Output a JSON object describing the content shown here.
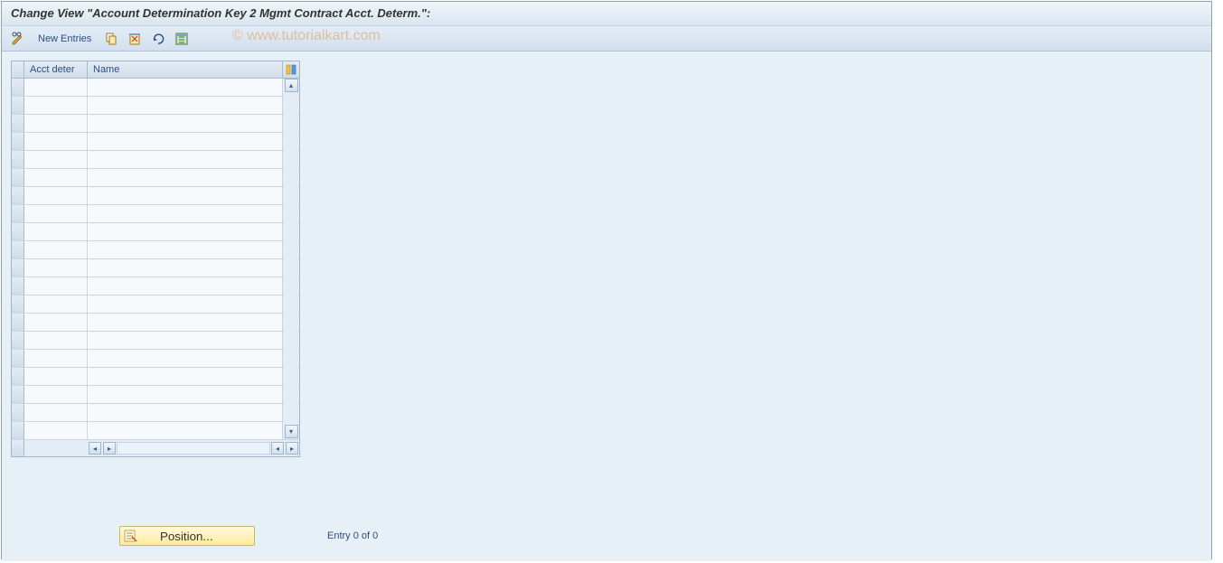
{
  "window": {
    "title": "Change View \"Account Determination Key 2 Mgmt Contract Acct. Determ.\":"
  },
  "toolbar": {
    "new_entries_label": "New Entries"
  },
  "watermark": "© www.tutorialkart.com",
  "table": {
    "columns": {
      "acct_deter": "Acct deter",
      "name": "Name"
    },
    "rows": [
      {
        "acct_deter": "",
        "name": ""
      },
      {
        "acct_deter": "",
        "name": ""
      },
      {
        "acct_deter": "",
        "name": ""
      },
      {
        "acct_deter": "",
        "name": ""
      },
      {
        "acct_deter": "",
        "name": ""
      },
      {
        "acct_deter": "",
        "name": ""
      },
      {
        "acct_deter": "",
        "name": ""
      },
      {
        "acct_deter": "",
        "name": ""
      },
      {
        "acct_deter": "",
        "name": ""
      },
      {
        "acct_deter": "",
        "name": ""
      },
      {
        "acct_deter": "",
        "name": ""
      },
      {
        "acct_deter": "",
        "name": ""
      },
      {
        "acct_deter": "",
        "name": ""
      },
      {
        "acct_deter": "",
        "name": ""
      },
      {
        "acct_deter": "",
        "name": ""
      },
      {
        "acct_deter": "",
        "name": ""
      },
      {
        "acct_deter": "",
        "name": ""
      },
      {
        "acct_deter": "",
        "name": ""
      },
      {
        "acct_deter": "",
        "name": ""
      },
      {
        "acct_deter": "",
        "name": ""
      }
    ]
  },
  "footer": {
    "position_label": "Position...",
    "entry_status": "Entry 0 of 0"
  }
}
